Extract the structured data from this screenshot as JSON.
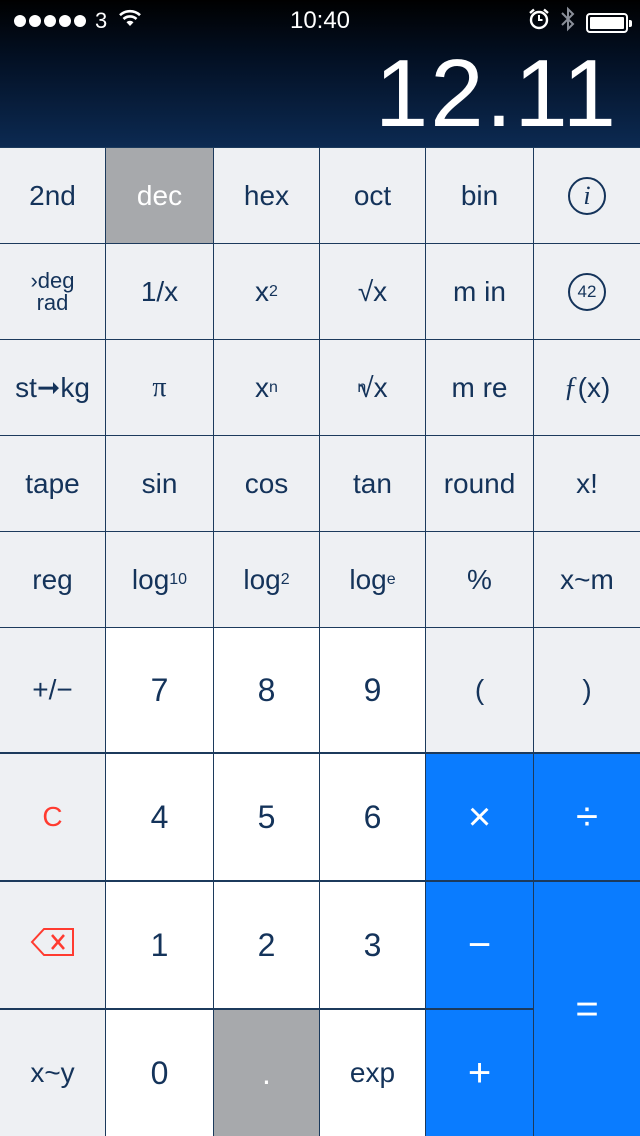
{
  "status_bar": {
    "carrier": "3",
    "time": "10:40"
  },
  "display": {
    "value": "12.11"
  },
  "colors": {
    "blue_key": "#0a7cff",
    "selected_key": "#a7a9ac",
    "clear_red": "#ff3b30",
    "label_navy": "#14335a"
  },
  "keys": {
    "second": "2nd",
    "dec": "dec",
    "hex": "hex",
    "oct": "oct",
    "bin": "bin",
    "info": "i",
    "deg_prefix": "›deg",
    "rad": "rad",
    "reciprocal": "1/x",
    "square_base": "x",
    "square_exp": "2",
    "sqrt": "√x",
    "m_in": "m in",
    "answer": "42",
    "st_kg": "st➞kg",
    "pi": "π",
    "power_base": "x",
    "power_exp": "n",
    "nroot_index": "n",
    "nroot_rest": "√x",
    "m_re": "m re",
    "fx_f": "ƒ",
    "fx_rest": "(x)",
    "tape": "tape",
    "sin": "sin",
    "cos": "cos",
    "tan": "tan",
    "round": "round",
    "factorial": "x!",
    "reg": "reg",
    "log10_base": "log",
    "log10_sub": "10",
    "log2_base": "log",
    "log2_sub": "2",
    "loge_base": "log",
    "loge_sub": "e",
    "percent": "%",
    "x_m": "x~m",
    "sign": "+/−",
    "seven": "7",
    "eight": "8",
    "nine": "9",
    "open_paren": "(",
    "close_paren": ")",
    "clear": "C",
    "four": "4",
    "five": "5",
    "six": "6",
    "multiply": "×",
    "divide": "÷",
    "one": "1",
    "two": "2",
    "three": "3",
    "minus": "−",
    "equals": "=",
    "x_y": "x~y",
    "zero": "0",
    "decimal": ".",
    "exp": "exp",
    "plus": "+"
  }
}
